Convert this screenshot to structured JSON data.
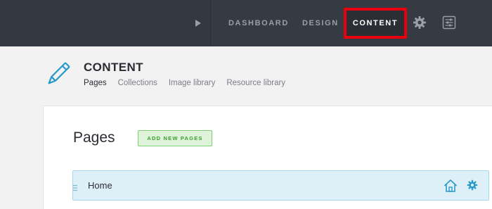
{
  "topbar": {
    "nav": {
      "dashboard": "DASHBOARD",
      "design": "DESIGN",
      "content": "CONTENT"
    },
    "icons": {
      "expand": "play-icon",
      "settings": "gear-icon",
      "preferences": "sliders-icon"
    },
    "highlight_color": "#e8000f"
  },
  "header": {
    "icon": "pencil-icon",
    "title": "CONTENT",
    "subnav": [
      {
        "label": "Pages",
        "active": true
      },
      {
        "label": "Collections",
        "active": false
      },
      {
        "label": "Image library",
        "active": false
      },
      {
        "label": "Resource library",
        "active": false
      }
    ]
  },
  "main": {
    "title": "Pages",
    "add_button": "ADD NEW PAGES",
    "rows": [
      {
        "label": "Home",
        "icons": [
          "home-icon",
          "gear-icon"
        ]
      }
    ]
  },
  "colors": {
    "topbar_bg": "#353a43",
    "accent_blue": "#2b9ac9",
    "add_green": "#3aa02f",
    "row_bg": "#ddf0f8"
  }
}
